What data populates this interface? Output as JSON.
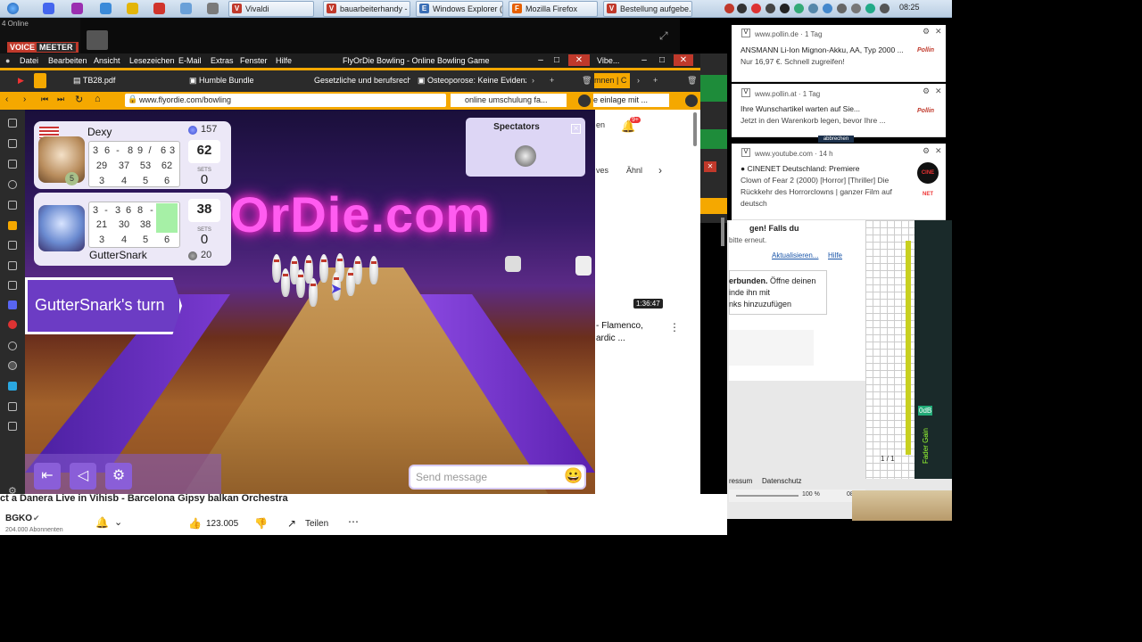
{
  "taskbar": {
    "tasks": [
      {
        "label": "Vivaldi"
      },
      {
        "label": "bauarbeiterhandy - ..."
      },
      {
        "label": "Windows Explorer (..."
      },
      {
        "label": "Mozilla Firefox"
      },
      {
        "label": "Bestellung aufgebe..."
      }
    ],
    "clock": "08:25"
  },
  "voicemeeter": {
    "brand_a": "VOICE",
    "brand_b": "MEETER",
    "online": "4 Online"
  },
  "menubar": {
    "items": [
      "Datei",
      "Bearbeiten",
      "Ansicht",
      "Lesezeichen",
      "E-Mail",
      "Extras",
      "Fenster",
      "Hilfe"
    ],
    "title": "FlyOrDie Bowling - Online Bowling Game",
    "right_tab": "Vibe..."
  },
  "tabs": [
    {
      "label": "TB28.pdf"
    },
    {
      "label": "Humble Bundle"
    },
    {
      "label": "Gesetzliche und berufsrechtli..."
    },
    {
      "label": "Osteoporose: Keine Evidenz f..."
    },
    {
      "label": "mnen | C"
    }
  ],
  "address": {
    "url": "www.flyordie.com/bowling",
    "search": "online umschulung fa...",
    "search2": "e einlage mit ..."
  },
  "game": {
    "neon": "OrDie.com",
    "players": [
      {
        "name": "Dexy",
        "rank": "157",
        "badge": "5",
        "frames_top": [
          "3",
          "6",
          "-",
          "8",
          "9",
          "/",
          "6",
          "3"
        ],
        "frames_mid": [
          "29",
          "37",
          "53",
          "62"
        ],
        "frames_bot": [
          "3",
          "4",
          "5",
          "6"
        ],
        "score": "62",
        "sets_label": "SETS",
        "sets": "0"
      },
      {
        "name": "GutterSnark",
        "rank": "20",
        "frames_top": [
          "3",
          "-",
          "3",
          "6",
          "8",
          "-"
        ],
        "frames_mid": [
          "21",
          "30",
          "38"
        ],
        "frames_bot": [
          "3",
          "4",
          "5",
          "6"
        ],
        "score": "38",
        "sets_label": "SETS",
        "sets": "0"
      }
    ],
    "turn_label": "GutterSnark's turn",
    "spectators_title": "Spectators",
    "chat_placeholder": "Send message",
    "emoji": "😀"
  },
  "right_page": {
    "label_ves": "ves",
    "label_ahn": "Ähnl",
    "video_time": "1:36:47",
    "video_title_1": "- Flamenco,",
    "video_title_2": "ardic ...",
    "bell_badge": "9+",
    "yt_en": "en"
  },
  "youtube_bottom": {
    "channel": "BGKO",
    "subs": "204.000 Abonnenten",
    "likes": "123.005",
    "share": "Teilen",
    "title_strip": "ct a Danera Live in Vihisb - Barcelona Gipsy balkan Orchestra"
  },
  "notifications": [
    {
      "source": "www.pollin.de · 1 Tag",
      "line1": "ANSMANN Li-Ion Mignon-Akku, AA, Typ 2000 ...",
      "line2": "Nur 16,97 €. Schnell zugreifen!",
      "logo": "Pollin"
    },
    {
      "source": "www.pollin.at · 1 Tag",
      "line1": "Ihre Wunschartikel warten auf Sie...",
      "line2": "Jetzt in den Warenkorb legen, bevor Ihre ...",
      "logo": "Pollin"
    },
    {
      "source": "www.youtube.com · 14 h",
      "line1": "CINENET Deutschland: Premiere",
      "line2": "Clown of Fear 2 (2000) [Horror] [Thriller] Die Rückkehr des Horrorclowns | ganzer Film auf deutsch",
      "logo": "CINE NET"
    }
  ],
  "right_panel": {
    "gen": "gen! Falls du",
    "bitte": "bitte erneut.",
    "aktual": "Aktualisieren...",
    "hilfe": "Hilfe",
    "verb1": "erbunden.",
    "verb1b": "Öffne deinen",
    "verb2": "inde ihn mit",
    "verb3": "nks hinzuzufügen",
    "abbrechen": "abbrechen",
    "ressum": "ressum",
    "datenschutz": "Datenschutz",
    "zoom": "100 %",
    "clock2": "08:25",
    "page": "1 / 1",
    "fader": "Fader Gain",
    "db": "0dB"
  }
}
